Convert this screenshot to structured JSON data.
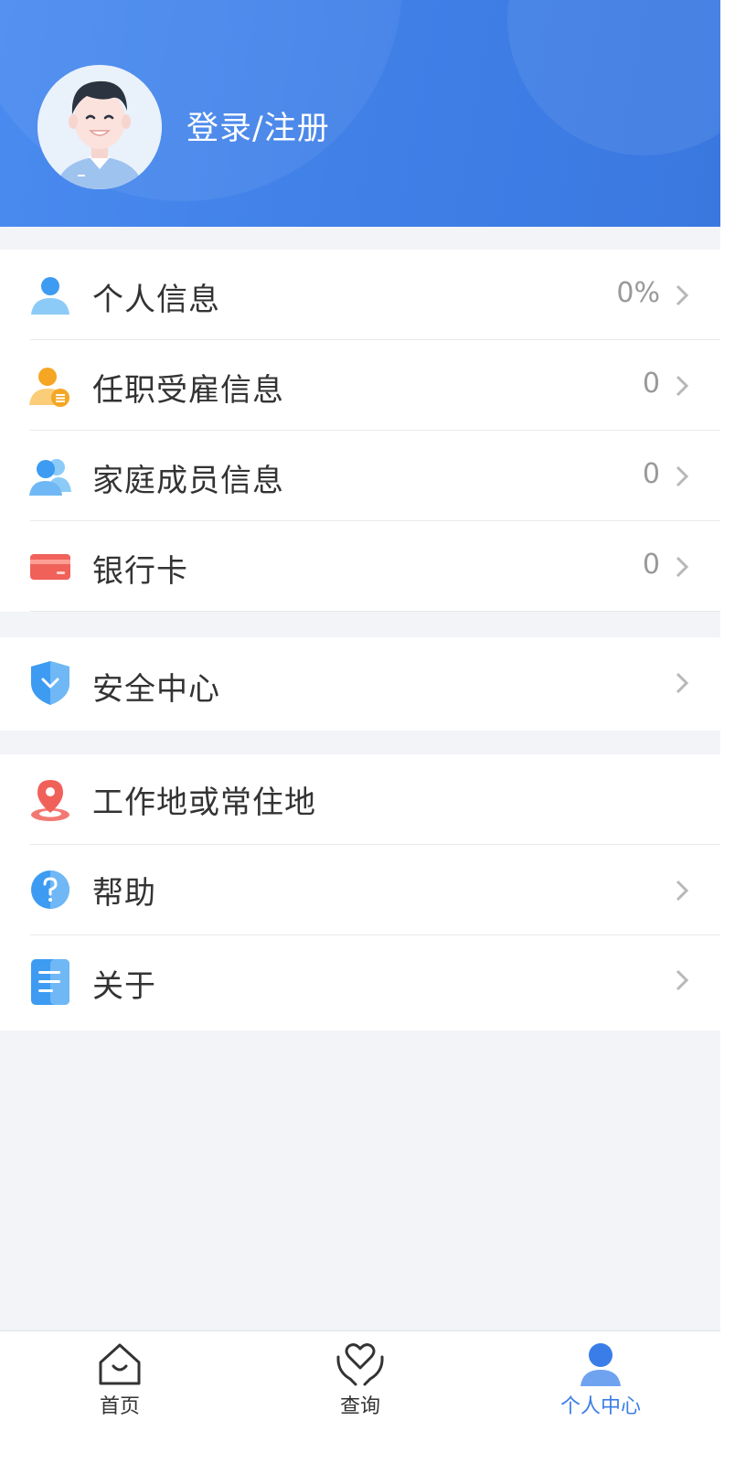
{
  "header": {
    "login_label": "登录/注册",
    "gradient_start": "#4a8bf0",
    "gradient_end": "#3a78e0"
  },
  "menu_groups": [
    {
      "items": [
        {
          "label": "个人信息",
          "value": "0%",
          "icon": "person-icon",
          "icon_color": "#3d9bf2"
        },
        {
          "label": "任职受雇信息",
          "value": "0",
          "icon": "employment-icon",
          "icon_color": "#f5a623"
        },
        {
          "label": "家庭成员信息",
          "value": "0",
          "icon": "family-icon",
          "icon_color": "#3d9bf2"
        },
        {
          "label": "银行卡",
          "value": "0",
          "icon": "bank-card-icon",
          "icon_color": "#f0615a"
        }
      ]
    },
    {
      "items": [
        {
          "label": "安全中心",
          "value": "",
          "icon": "shield-icon",
          "icon_color": "#3d9bf2"
        }
      ]
    },
    {
      "items": [
        {
          "label": "工作地或常住地",
          "value": "",
          "icon": "location-pin-icon",
          "icon_color": "#f0615a"
        },
        {
          "label": "帮助",
          "value": "",
          "icon": "help-icon",
          "icon_color": "#3d9bf2"
        },
        {
          "label": "关于",
          "value": "",
          "icon": "document-icon",
          "icon_color": "#3d9bf2"
        }
      ]
    }
  ],
  "tabbar": {
    "tabs": [
      {
        "label": "首页",
        "icon": "home-icon"
      },
      {
        "label": "查询",
        "icon": "heart-hands-icon"
      },
      {
        "label": "个人中心",
        "icon": "profile-icon",
        "active": true
      }
    ],
    "active_color": "#3b7de8"
  }
}
